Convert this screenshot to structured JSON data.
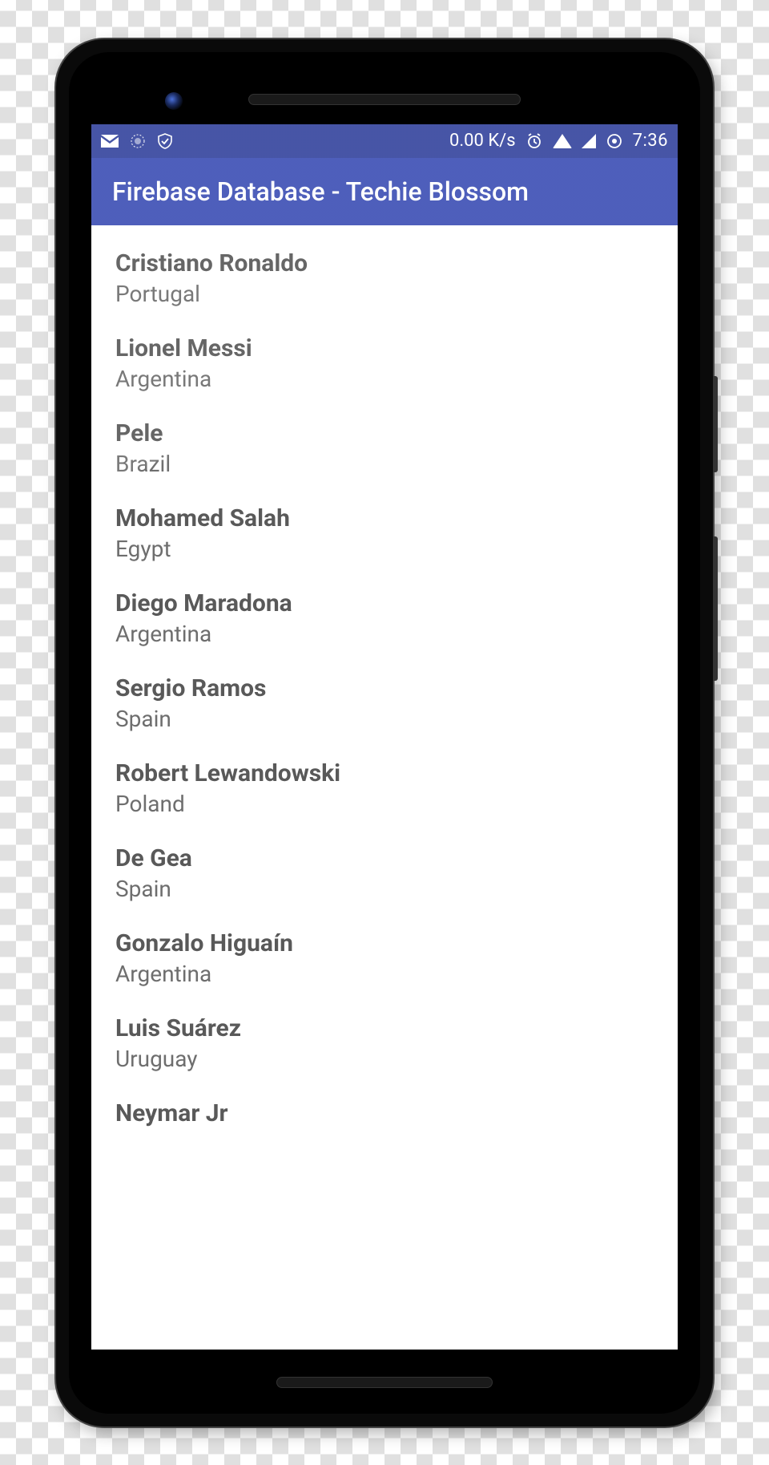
{
  "status_bar": {
    "speed": "0.00 K/s",
    "time": "7:36"
  },
  "app_bar": {
    "title": "Firebase Database - Techie Blossom"
  },
  "players": [
    {
      "name": "Cristiano Ronaldo",
      "country": "Portugal"
    },
    {
      "name": "Lionel Messi",
      "country": "Argentina"
    },
    {
      "name": "Pele",
      "country": "Brazil"
    },
    {
      "name": "Mohamed Salah",
      "country": "Egypt"
    },
    {
      "name": "Diego Maradona",
      "country": "Argentina"
    },
    {
      "name": "Sergio Ramos",
      "country": "Spain"
    },
    {
      "name": "Robert Lewandowski",
      "country": "Poland"
    },
    {
      "name": "De Gea",
      "country": "Spain"
    },
    {
      "name": "Gonzalo Higuaín",
      "country": "Argentina"
    },
    {
      "name": "Luis Suárez",
      "country": "Uruguay"
    },
    {
      "name": "Neymar Jr",
      "country": ""
    }
  ]
}
